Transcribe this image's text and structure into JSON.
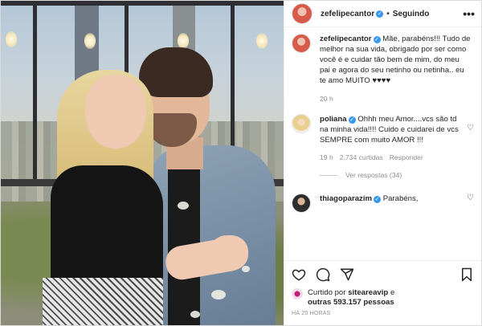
{
  "post": {
    "username": "zefelipecantor",
    "follow_state": "Seguindo",
    "separator": "•",
    "more_glyph": "•••"
  },
  "caption": {
    "username": "zefelipecantor",
    "text": "Mãe, parabéns!!! Tudo de melhor na sua vida, obrigado por ser como você é e cuidar tão bem de mim, do meu pai e agora do seu netinho ou netinha.. eu te amo MUITO ♥♥♥♥",
    "time": "20 h"
  },
  "comments": [
    {
      "username": "poliana",
      "text": "Ohhh meu Amor....vcs são td na minha vida!!!! Cuido e cuidarei de vcs SEMPRE com muito AMOR !!!",
      "time": "19 h",
      "likes": "2.734 curtidas",
      "reply_label": "Responder",
      "view_replies": "Ver respostas (34)"
    },
    {
      "username": "thiagoparazim",
      "text": "Parabéns,"
    }
  ],
  "likes": {
    "prefix": "Curtido por",
    "user": "siteareavip",
    "and": "e",
    "others": "outras 593.157 pessoas"
  },
  "timestamp": "HÁ 20 HORAS",
  "icons": {
    "like": "heart-icon",
    "comment": "comment-icon",
    "share": "share-icon",
    "save": "bookmark-icon",
    "verified": "verified-badge-icon",
    "more": "more-options-icon"
  },
  "colors": {
    "verified": "#3897f0",
    "muted_text": "#8e8e8e",
    "text": "#262626"
  }
}
